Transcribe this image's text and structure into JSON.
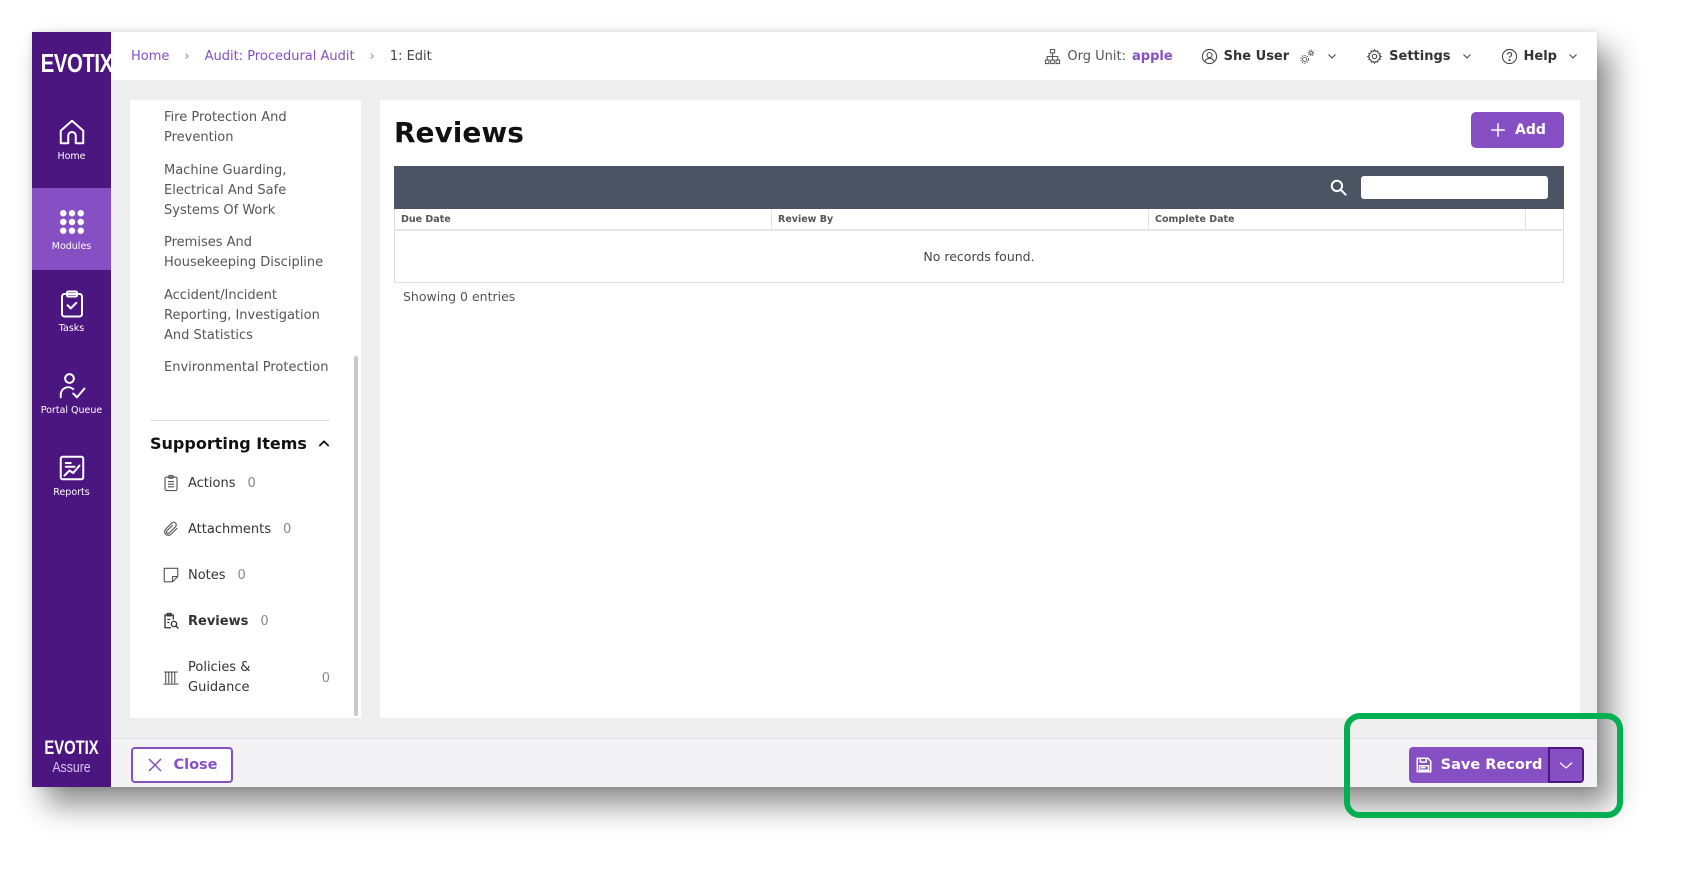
{
  "brand": {
    "logo_text": "EVOTIX",
    "product_line1": "EVOTIX",
    "product_line2": "Assure"
  },
  "sidebar": {
    "items": [
      {
        "label": "Home",
        "icon": "home-icon",
        "active": false
      },
      {
        "label": "Modules",
        "icon": "grid-dots-icon",
        "active": true
      },
      {
        "label": "Tasks",
        "icon": "clipboard-check-icon",
        "active": false
      },
      {
        "label": "Portal Queue",
        "icon": "user-check-icon",
        "active": false
      },
      {
        "label": "Reports",
        "icon": "chart-report-icon",
        "active": false
      }
    ]
  },
  "breadcrumb": {
    "items": [
      {
        "label": "Home"
      },
      {
        "label": "Audit: Procedural Audit"
      },
      {
        "label": "1: Edit"
      }
    ]
  },
  "topbar": {
    "org_unit_label": "Org Unit:",
    "org_unit_value": "apple",
    "user_name": "She User",
    "settings_label": "Settings",
    "help_label": "Help"
  },
  "left_panel": {
    "sections": [
      {
        "label": "Fire Protection And Prevention"
      },
      {
        "label": "Machine Guarding, Electrical And Safe Systems Of Work"
      },
      {
        "label": "Premises And Housekeeping Discipline"
      },
      {
        "label": "Accident/Incident Reporting, Investigation And Statistics"
      },
      {
        "label": "Environmental Protection"
      }
    ],
    "supporting_items": {
      "title": "Supporting Items",
      "items": [
        {
          "label": "Actions",
          "count": "0",
          "icon": "clipboard-list-icon"
        },
        {
          "label": "Attachments",
          "count": "0",
          "icon": "paperclip-icon"
        },
        {
          "label": "Notes",
          "count": "0",
          "icon": "note-icon"
        },
        {
          "label": "Reviews",
          "count": "0",
          "icon": "review-search-icon"
        },
        {
          "label": "Policies & Guidance",
          "count": "0",
          "icon": "books-icon"
        }
      ]
    }
  },
  "main": {
    "title": "Reviews",
    "add_label": "Add",
    "search": {
      "value": "",
      "placeholder": ""
    },
    "columns": [
      "Due Date",
      "Review By",
      "Complete Date",
      ""
    ],
    "empty_message": "No records found.",
    "footer_text": "Showing 0 entries"
  },
  "footer": {
    "close_label": "Close",
    "save_label": "Save Record"
  },
  "colors": {
    "brand_purple": "#4b1680",
    "accent_purple": "#8650c4",
    "toolbar_slate": "#4b5463",
    "highlight_green": "#00b050"
  }
}
